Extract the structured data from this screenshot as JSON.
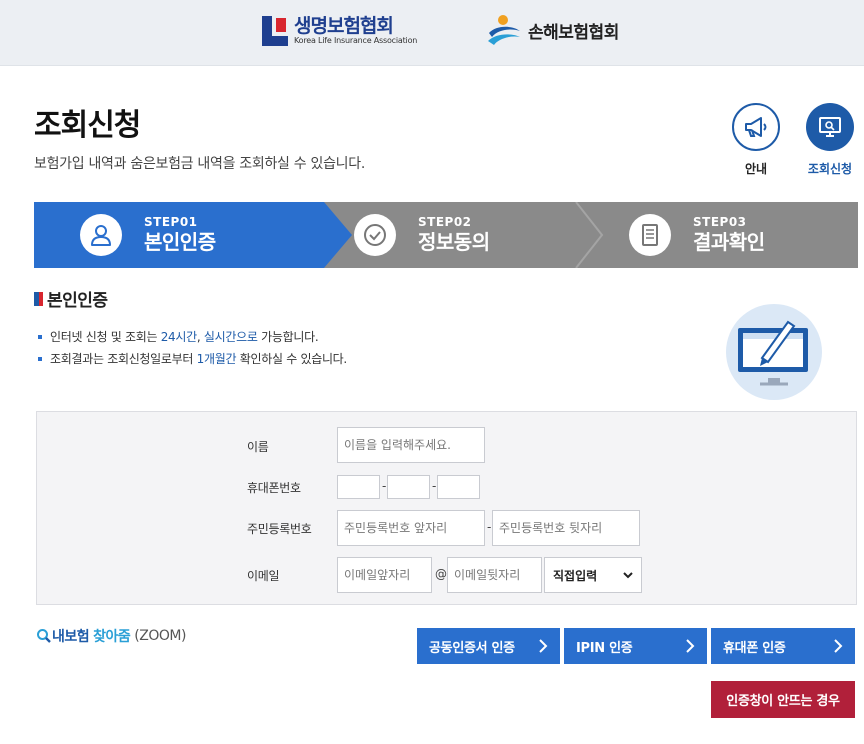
{
  "header": {
    "logo_life_ko": "생명보험협회",
    "logo_life_en": "Korea Life Insurance Association",
    "logo_nonlife_ko": "손해보험협회"
  },
  "page": {
    "title": "조회신청",
    "subtitle": "보험가입 내역과 숨은보험금 내역을 조회하실 수 있습니다.",
    "quick_guide": "안내",
    "quick_apply": "조회신청"
  },
  "steps": [
    {
      "num": "STEP01",
      "label": "본인인증",
      "icon": "user-icon"
    },
    {
      "num": "STEP02",
      "label": "정보동의",
      "icon": "check-circle-icon"
    },
    {
      "num": "STEP03",
      "label": "결과확인",
      "icon": "document-icon"
    }
  ],
  "section": {
    "title": "본인인증",
    "bullet1_a": "인터넷 신청 및 조회는 ",
    "bullet1_hl1": "24시간",
    "bullet1_b": ", ",
    "bullet1_hl2": "실시간으로",
    "bullet1_c": " 가능합니다.",
    "bullet2_a": "조회결과는 조회신청일로부터 ",
    "bullet2_hl": "1개월간",
    "bullet2_b": " 확인하실 수 있습니다."
  },
  "form": {
    "name_label": "이름",
    "name_placeholder": "이름을 입력해주세요.",
    "phone_label": "휴대폰번호",
    "phone_sep": "-",
    "rrn_label": "주민등록번호",
    "rrn_front_placeholder": "주민등록번호 앞자리",
    "rrn_back_placeholder": "주민등록번호 뒷자리",
    "rrn_sep": "-",
    "email_label": "이메일",
    "email_id_placeholder": "이메일앞자리",
    "email_at": "@",
    "email_domain_placeholder": "이메일뒷자리",
    "email_domain_select": "직접입력"
  },
  "bottom": {
    "zoom_a": "내보험",
    "zoom_b": "찾아줌",
    "zoom_c": "(ZOOM)",
    "btn_cert": "공동인증서 인증",
    "btn_ipin": "IPIN 인증",
    "btn_phone": "휴대폰 인증",
    "btn_help": "인증창이 안뜨는 경우"
  },
  "colors": {
    "primary": "#2a6fce",
    "step_inactive": "#8a8a8a",
    "danger": "#b1203a"
  }
}
